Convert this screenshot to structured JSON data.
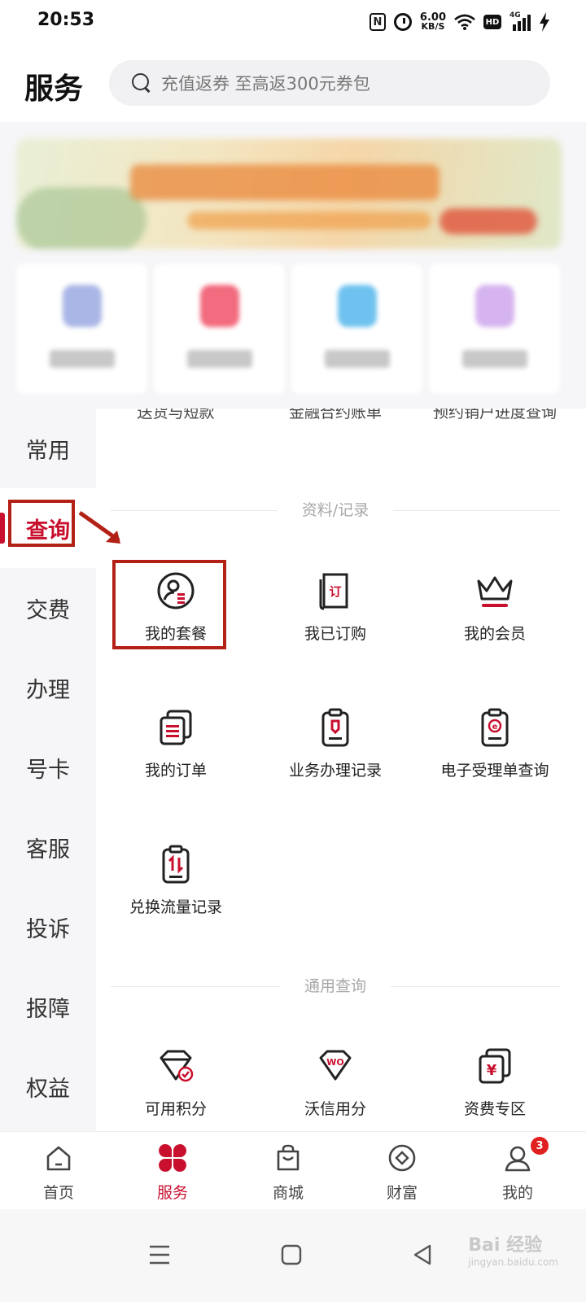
{
  "status_bar": {
    "time": "20:53",
    "nfc_label": "N",
    "net_speed_value": "6.00",
    "net_speed_unit": "KB/S",
    "hd_label": "HD",
    "signal_label": "4G"
  },
  "header": {
    "title": "服务",
    "search_placeholder": "充值返券 至高返300元券包"
  },
  "left_nav": {
    "items": [
      {
        "label": "常用"
      },
      {
        "label": "查询"
      },
      {
        "label": "交费"
      },
      {
        "label": "办理"
      },
      {
        "label": "号卡"
      },
      {
        "label": "客服"
      },
      {
        "label": "投诉"
      },
      {
        "label": "报障"
      },
      {
        "label": "权益"
      }
    ],
    "active": "查询"
  },
  "content": {
    "cut_row": [
      "送货与短款",
      "金融合约账单",
      "预约销户进度查询"
    ],
    "section1": {
      "title": "资料/记录",
      "items": [
        {
          "label": "我的套餐",
          "icon": "user-package-icon"
        },
        {
          "label": "我已订购",
          "icon": "ordered-doc-icon",
          "glyph": "订"
        },
        {
          "label": "我的会员",
          "icon": "crown-icon"
        },
        {
          "label": "我的订单",
          "icon": "orders-icon"
        },
        {
          "label": "业务办理记录",
          "icon": "clipboard-pen-icon"
        },
        {
          "label": "电子受理单查询",
          "icon": "clipboard-e-icon",
          "glyph": "e"
        },
        {
          "label": "兑换流量记录",
          "icon": "clipboard-exchange-icon"
        }
      ]
    },
    "section2": {
      "title": "通用查询",
      "items": [
        {
          "label": "可用积分",
          "icon": "points-diamond-icon"
        },
        {
          "label": "沃信用分",
          "icon": "wo-credit-icon",
          "glyph": "WO"
        },
        {
          "label": "资费专区",
          "icon": "tariff-yen-icon",
          "glyph": "¥"
        }
      ]
    }
  },
  "tab_bar": {
    "tabs": [
      {
        "label": "首页",
        "icon": "home-icon"
      },
      {
        "label": "服务",
        "icon": "service-clover-icon"
      },
      {
        "label": "商城",
        "icon": "shopping-bag-icon"
      },
      {
        "label": "财富",
        "icon": "wealth-coin-icon"
      },
      {
        "label": "我的",
        "icon": "profile-icon",
        "badge": "3"
      }
    ],
    "active": "服务"
  },
  "watermark": {
    "text": "Bai 经验",
    "sub": "jingyan.baidu.com"
  },
  "colors": {
    "accent": "#c8102e",
    "annotation": "#b32015"
  }
}
